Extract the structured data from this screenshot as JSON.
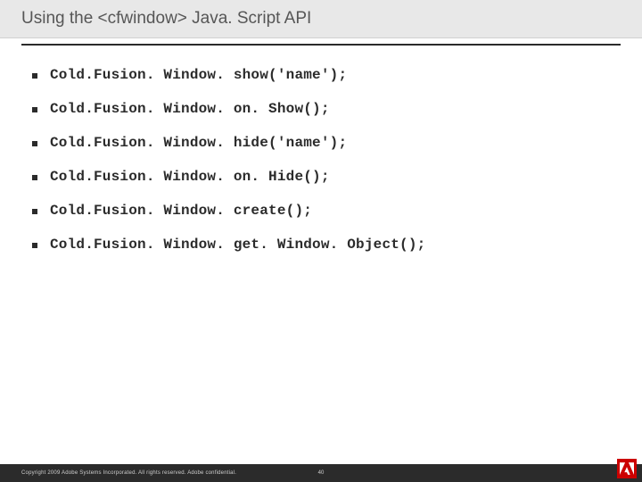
{
  "slide": {
    "title": "Using the <cfwindow> Java. Script API"
  },
  "bullets": [
    {
      "text": "Cold.Fusion. Window. show('name');"
    },
    {
      "text": "Cold.Fusion. Window. on. Show();"
    },
    {
      "text": "Cold.Fusion. Window. hide('name');"
    },
    {
      "text": "Cold.Fusion. Window. on. Hide();"
    },
    {
      "text": "Cold.Fusion. Window. create();"
    },
    {
      "text": "Cold.Fusion. Window. get. Window. Object();"
    }
  ],
  "footer": {
    "copyright": "Copyright 2009 Adobe Systems Incorporated.  All rights reserved.  Adobe confidential.",
    "page": "40"
  }
}
